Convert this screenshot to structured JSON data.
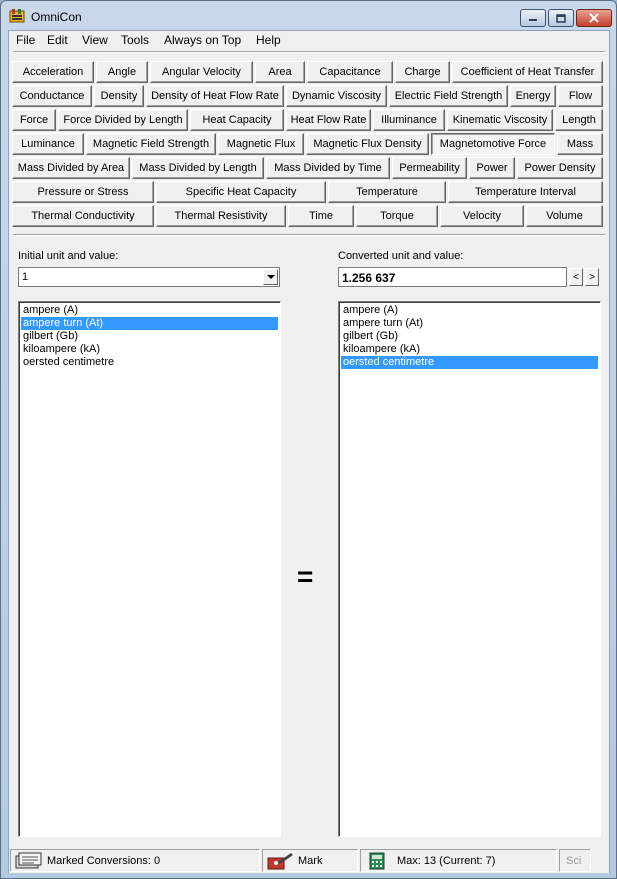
{
  "window": {
    "title": "OmniCon",
    "icon": "omnicon-app-icon",
    "controls": {
      "minimize": "minimize-icon",
      "maximize": "maximize-icon",
      "close": "close-icon"
    }
  },
  "menu": [
    "File",
    "Edit",
    "View",
    "Tools",
    "Always on Top",
    "Help"
  ],
  "quantities": {
    "selected": "Magnetomotive Force",
    "rows": [
      [
        "Acceleration",
        "Angle",
        "Angular Velocity",
        "Area",
        "Capacitance",
        "Charge",
        "Coefficient of Heat Transfer"
      ],
      [
        "Conductance",
        "Density",
        "Density of Heat Flow Rate",
        "Dynamic Viscosity",
        "Electric Field Strength",
        "Energy",
        "Flow"
      ],
      [
        "Force",
        "Force Divided by Length",
        "Heat Capacity",
        "Heat Flow Rate",
        "Illuminance",
        "Kinematic Viscosity",
        "Length"
      ],
      [
        "Luminance",
        "Magnetic Field Strength",
        "Magnetic Flux",
        "Magnetic Flux Density",
        "Magnetomotive Force",
        "Mass"
      ],
      [
        "Mass Divided by Area",
        "Mass Divided by Length",
        "Mass Divided by Time",
        "Permeability",
        "Power",
        "Power Density"
      ],
      [
        "Pressure or Stress",
        "Specific Heat Capacity",
        "Temperature",
        "Temperature Interval"
      ],
      [
        "Thermal Conductivity",
        "Thermal Resistivity",
        "Time",
        "Torque",
        "Velocity",
        "Volume"
      ]
    ]
  },
  "initial": {
    "label": "Initial unit and value:",
    "value": "1",
    "units": [
      "ampere (A)",
      "ampere turn (At)",
      "gilbert (Gb)",
      "kiloampere (kA)",
      "oersted centimetre"
    ],
    "selected_unit": "ampere turn (At)"
  },
  "converted": {
    "label": "Converted unit and value:",
    "value": "1.256 637",
    "prev_label": "<",
    "next_label": ">",
    "units": [
      "ampere (A)",
      "ampere turn (At)",
      "gilbert (Gb)",
      "kiloampere (kA)",
      "oersted centimetre"
    ],
    "selected_unit": "oersted centimetre"
  },
  "equals_sign": "=",
  "status": {
    "marked_conversions": "Marked Conversions: 0",
    "mark_label": "Mark",
    "max_current": "Max: 13  (Current: 7)",
    "sci_label": "Sci",
    "icons": [
      "marked-conversions-icon",
      "mark-icon",
      "calculator-icon"
    ]
  }
}
